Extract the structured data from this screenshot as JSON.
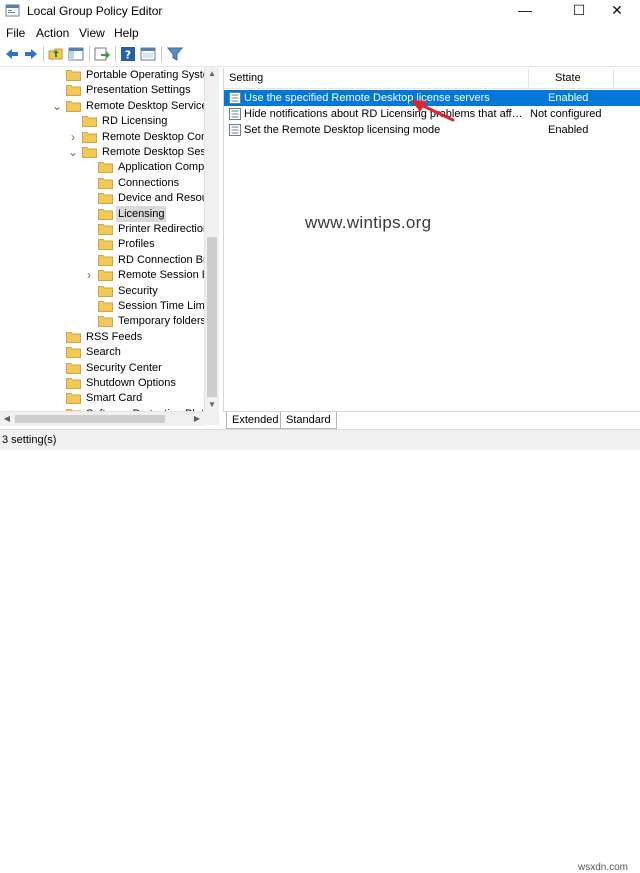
{
  "window": {
    "title": "Local Group Policy Editor",
    "minimize_glyph": "—",
    "maximize_glyph": "☐",
    "close_glyph": "✕"
  },
  "menu": [
    "File",
    "Action",
    "View",
    "Help"
  ],
  "toolbar": {
    "icons": [
      "back-icon",
      "forward-icon",
      "up-folder-icon",
      "show-tree-icon",
      "export-list-icon",
      "help-icon",
      "properties-icon",
      "filter-icon"
    ]
  },
  "tree": [
    {
      "label": "Portable Operating System",
      "level": 1,
      "expander": ""
    },
    {
      "label": "Presentation Settings",
      "level": 1,
      "expander": ""
    },
    {
      "label": "Remote Desktop Services",
      "level": 1,
      "expander": "expanded"
    },
    {
      "label": "RD Licensing",
      "level": 2,
      "expander": ""
    },
    {
      "label": "Remote Desktop Conn",
      "level": 2,
      "expander": "collapsed"
    },
    {
      "label": "Remote Desktop Sessic",
      "level": 2,
      "expander": "expanded"
    },
    {
      "label": "Application Compa",
      "level": 3,
      "expander": ""
    },
    {
      "label": "Connections",
      "level": 3,
      "expander": ""
    },
    {
      "label": "Device and Resourc",
      "level": 3,
      "expander": ""
    },
    {
      "label": "Licensing",
      "level": 3,
      "expander": "",
      "selected": true
    },
    {
      "label": "Printer Redirection",
      "level": 3,
      "expander": ""
    },
    {
      "label": "Profiles",
      "level": 3,
      "expander": ""
    },
    {
      "label": "RD Connection Bro",
      "level": 3,
      "expander": ""
    },
    {
      "label": "Remote Session En",
      "level": 3,
      "expander": "collapsed"
    },
    {
      "label": "Security",
      "level": 3,
      "expander": ""
    },
    {
      "label": "Session Time Limit",
      "level": 3,
      "expander": ""
    },
    {
      "label": "Temporary folders",
      "level": 3,
      "expander": ""
    },
    {
      "label": "RSS Feeds",
      "level": 1,
      "expander": ""
    },
    {
      "label": "Search",
      "level": 1,
      "expander": ""
    },
    {
      "label": "Security Center",
      "level": 1,
      "expander": ""
    },
    {
      "label": "Shutdown Options",
      "level": 1,
      "expander": ""
    },
    {
      "label": "Smart Card",
      "level": 1,
      "expander": ""
    },
    {
      "label": "Software Protection Platf",
      "level": 1,
      "expander": ""
    }
  ],
  "list": {
    "columns": [
      "Setting",
      "State"
    ],
    "rows": [
      {
        "name": "Use the specified Remote Desktop license servers",
        "state": "Enabled",
        "selected": true
      },
      {
        "name": "Hide notifications about RD Licensing problems that affect t...",
        "state": "Not configured",
        "selected": false
      },
      {
        "name": "Set the Remote Desktop licensing mode",
        "state": "Enabled",
        "selected": false
      }
    ]
  },
  "tabs": [
    {
      "label": "Extended",
      "active": false
    },
    {
      "label": "Standard",
      "active": true
    }
  ],
  "status": "3 setting(s)",
  "watermark": "www.wintips.org",
  "corner_watermark": "wsxdn.com",
  "colors": {
    "selection": "#0078d7",
    "folder": "#f4c75a",
    "arrow": "#e0262a"
  }
}
